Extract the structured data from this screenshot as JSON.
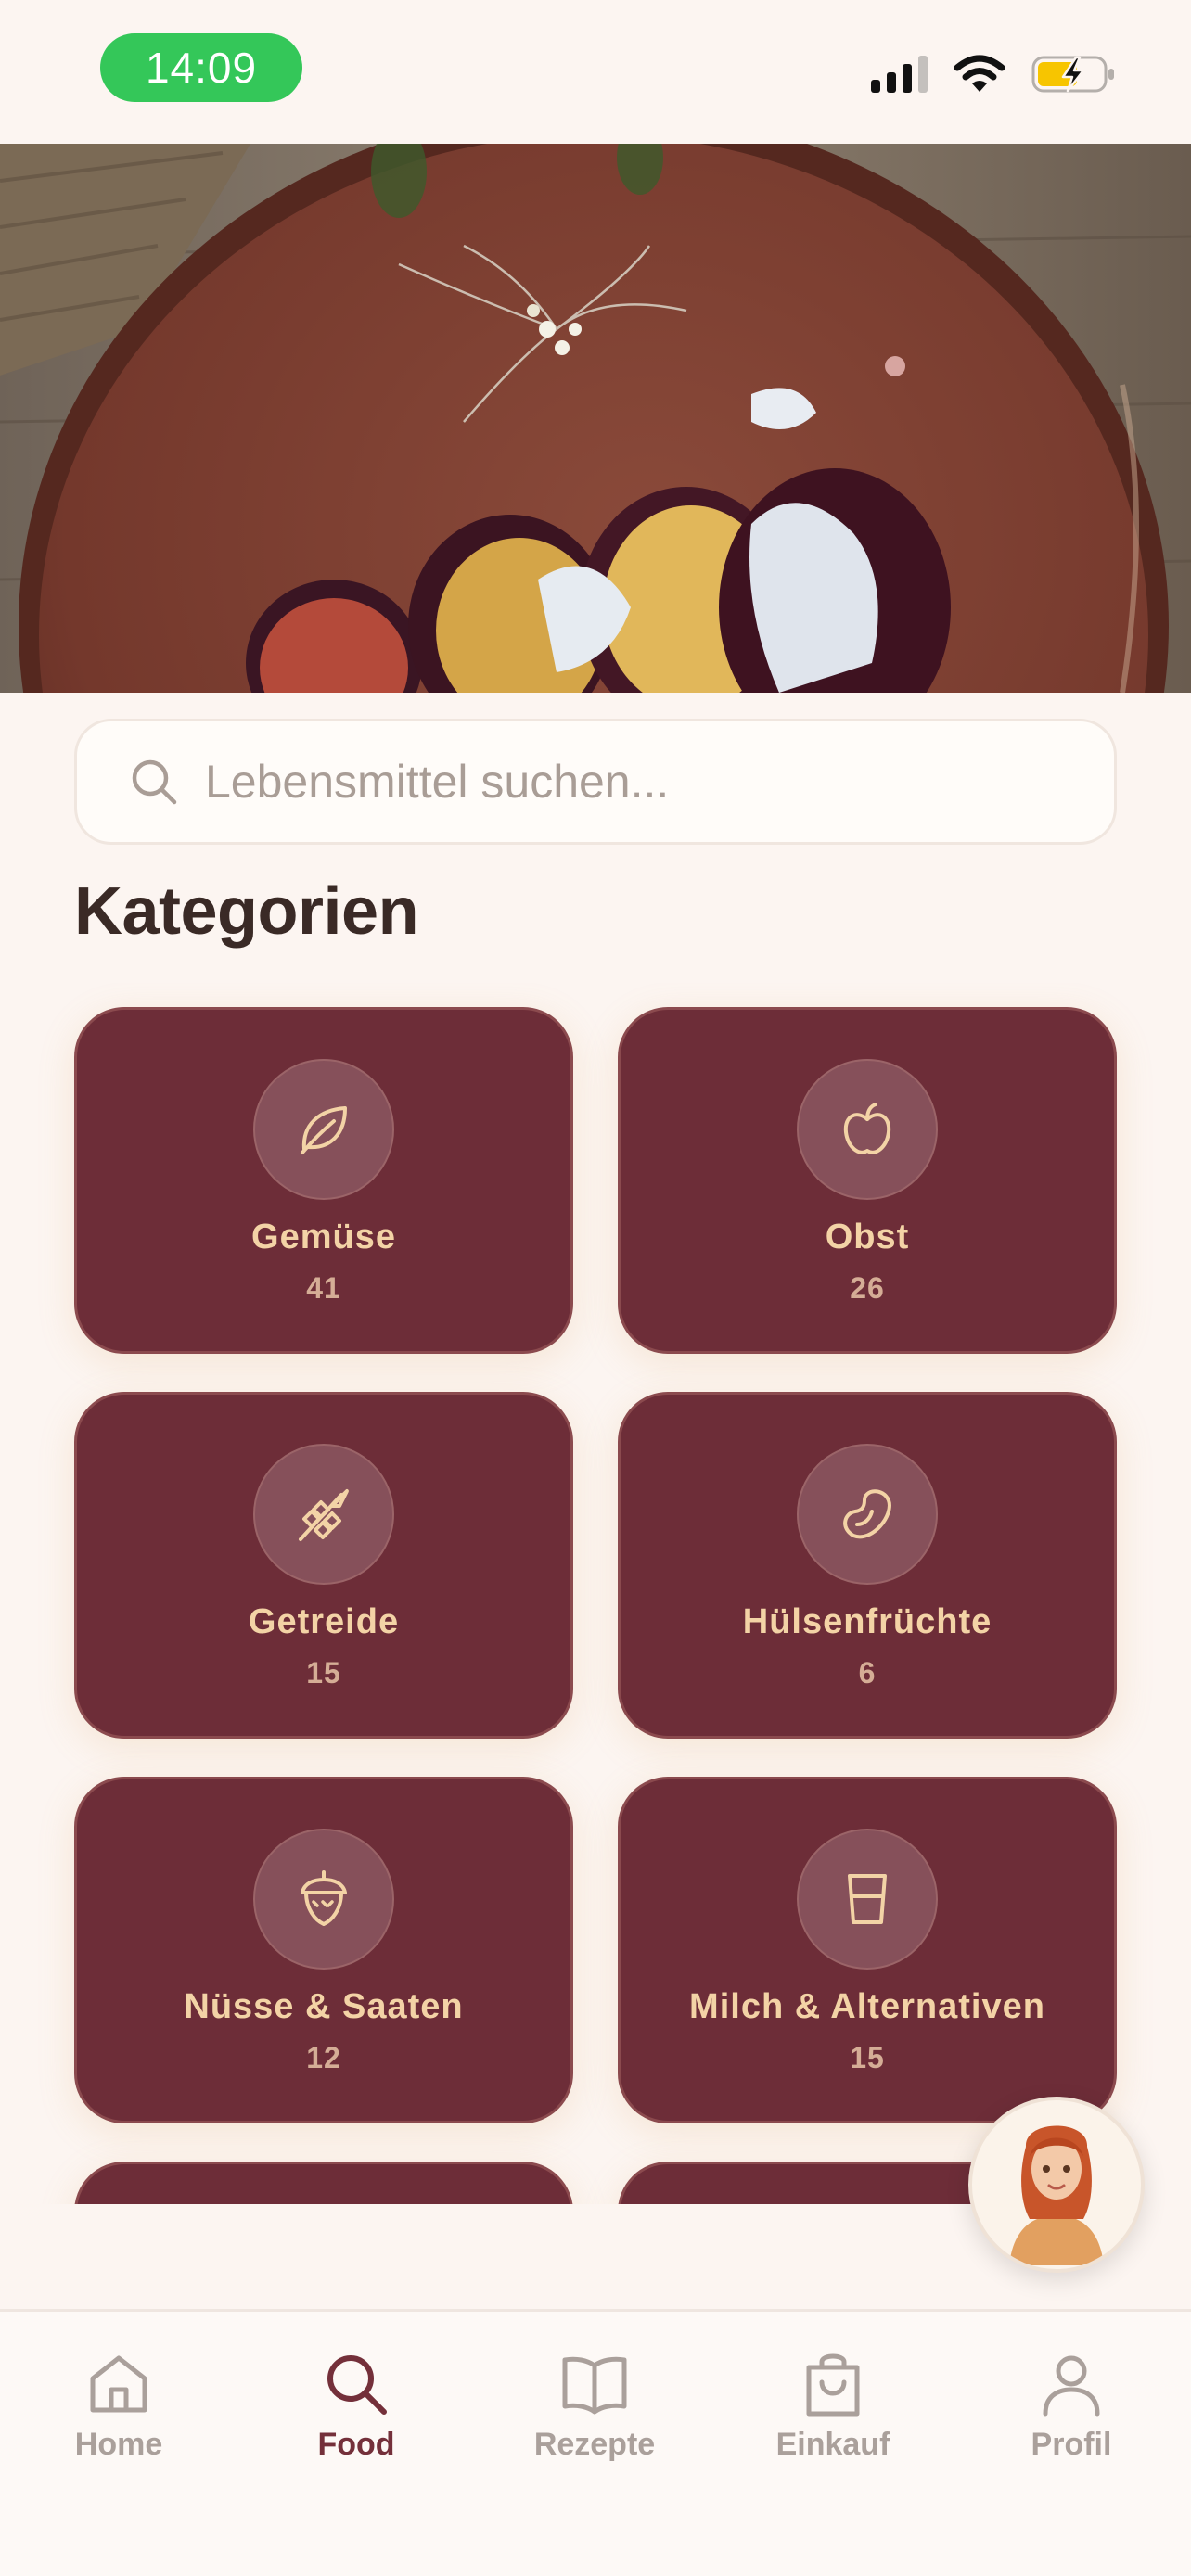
{
  "status_bar": {
    "time": "14:09",
    "icons": [
      "cellular-signal-icon",
      "wifi-icon",
      "battery-charging-icon"
    ]
  },
  "hero": {
    "image": "roasted beetroot slices with sauce on a terracotta plate"
  },
  "search": {
    "placeholder": "Lebensmittel suchen...",
    "value": "",
    "icon": "search-icon"
  },
  "categories_section": {
    "title": "Kategorien",
    "items": [
      {
        "name": "Gemüse",
        "count": "41",
        "icon": "leaf-icon"
      },
      {
        "name": "Obst",
        "count": "26",
        "icon": "apple-icon"
      },
      {
        "name": "Getreide",
        "count": "15",
        "icon": "wheat-icon"
      },
      {
        "name": "Hülsenfrüchte",
        "count": "6",
        "icon": "bean-icon"
      },
      {
        "name": "Nüsse & Saaten",
        "count": "12",
        "icon": "acorn-icon"
      },
      {
        "name": "Milch & Alternativen",
        "count": "15",
        "icon": "glass-icon"
      }
    ]
  },
  "assistant": {
    "icon": "assistant-avatar"
  },
  "nav": {
    "active": "Food",
    "items": [
      {
        "label": "Home",
        "icon": "home-icon"
      },
      {
        "label": "Food",
        "icon": "search-icon"
      },
      {
        "label": "Rezepte",
        "icon": "book-icon"
      },
      {
        "label": "Einkauf",
        "icon": "shopping-bag-icon"
      },
      {
        "label": "Profil",
        "icon": "user-icon"
      }
    ]
  },
  "colors": {
    "background": "#fcf5f1",
    "card": "#6d2d38",
    "card_text": "#f3d3a6",
    "accent": "#74303a",
    "time_pill": "#34c759",
    "battery_charge": "#f7c500"
  }
}
